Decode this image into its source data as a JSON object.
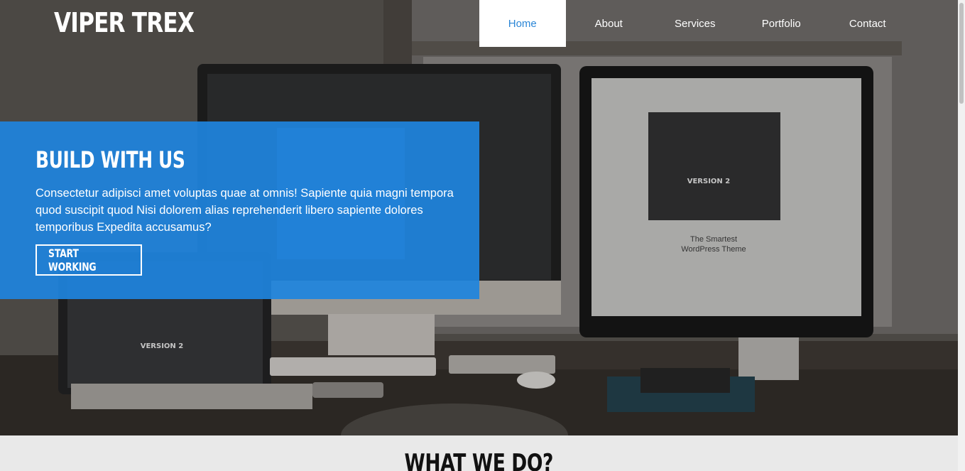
{
  "brand": {
    "logo": "VIPER TREX"
  },
  "nav": {
    "items": [
      {
        "label": "Home",
        "active": true
      },
      {
        "label": "About",
        "active": false
      },
      {
        "label": "Services",
        "active": false
      },
      {
        "label": "Portfolio",
        "active": false
      },
      {
        "label": "Contact",
        "active": false
      }
    ]
  },
  "hero": {
    "title": "BUILD WITH US",
    "text": "Consectetur adipisci amet voluptas quae at omnis! Sapiente quia magni tempora quod suscipit quod Nisi dolorem alias reprehenderit libero sapiente dolores temporibus Expedita accusamus?",
    "button_label": "START WORKING",
    "screen_lines": [
      "The Smartest",
      "WordPress Theme"
    ],
    "badge": "VERSION 2"
  },
  "section": {
    "title": "WHAT WE DO?"
  },
  "colors": {
    "accent": "#2b86d6",
    "cta_bg": "#1e84de",
    "page_bg": "#e9e9e9"
  }
}
